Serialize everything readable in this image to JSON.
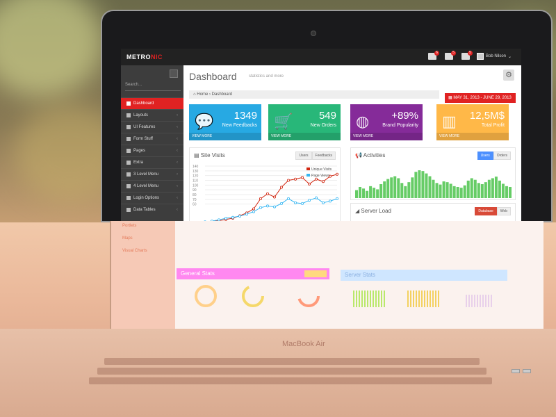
{
  "topbar": {
    "logo_main": "METRO",
    "logo_accent": "NIC",
    "notif_badges": [
      "6",
      "5",
      "5"
    ],
    "user_name": "Bob Nilson",
    "user_caret": "⌄"
  },
  "sidebar": {
    "search_placeholder": "Search...",
    "items": [
      {
        "label": "Dashboard"
      },
      {
        "label": "Layouts"
      },
      {
        "label": "UI Features"
      },
      {
        "label": "Form Stuff"
      },
      {
        "label": "Pages"
      },
      {
        "label": "Extra"
      },
      {
        "label": "3 Level Menu"
      },
      {
        "label": "4 Level Menu"
      },
      {
        "label": "Login Options"
      },
      {
        "label": "Data Tables"
      }
    ],
    "reflected_items": [
      "Portlets",
      "Maps",
      "Visual Charts"
    ]
  },
  "main": {
    "title": "Dashboard",
    "subtitle": "statistics and more",
    "date_range": "MAY 31, 2013 - JUNE 29, 2013",
    "breadcrumb": {
      "home": "Home",
      "separator": "›",
      "current": "Dashboard"
    },
    "stats": [
      {
        "value": "1349",
        "label": "New Feedbacks",
        "more": "VIEW MORE",
        "color": "#27a9e3"
      },
      {
        "value": "549",
        "label": "New Orders",
        "more": "VIEW MORE",
        "color": "#28b779"
      },
      {
        "value": "+89%",
        "label": "Brand Popularity",
        "more": "VIEW MORE",
        "color": "#852b99"
      },
      {
        "value": "12,5M$",
        "label": "Total Profit",
        "more": "VIEW MORE",
        "color": "#ffb848"
      }
    ],
    "site_visits": {
      "title": "Site Visits",
      "buttons": [
        "Users",
        "Feedbacks"
      ],
      "legend": [
        "Unique Visits",
        "Page Views"
      ]
    },
    "activities": {
      "title": "Activities",
      "buttons": [
        "Users",
        "Orders"
      ]
    },
    "server_load": {
      "title": "Server Load",
      "buttons": [
        "Database",
        "Web"
      ]
    },
    "general_stats": {
      "title": "General Stats"
    },
    "server_stats": {
      "title": "Server Stats"
    }
  },
  "chart_data": [
    {
      "type": "line",
      "title": "Site Visits",
      "ylim": [
        0,
        140
      ],
      "yticks": [
        140,
        130,
        120,
        110,
        100,
        90,
        80,
        70,
        60
      ],
      "series": [
        {
          "name": "Unique Visits",
          "color": "#d12610",
          "values": [
            2,
            4,
            6,
            9,
            12,
            18,
            25,
            35,
            60,
            72,
            64,
            88,
            105,
            108,
            112,
            96,
            108,
            102,
            115,
            120
          ]
        },
        {
          "name": "Page Views",
          "color": "#37b7f3",
          "values": [
            3,
            5,
            8,
            12,
            14,
            17,
            22,
            28,
            38,
            42,
            40,
            48,
            60,
            50,
            48,
            56,
            62,
            50,
            54,
            60
          ]
        }
      ]
    },
    {
      "type": "bar",
      "title": "Activities",
      "color": "#66cc66",
      "values": [
        20,
        28,
        24,
        18,
        30,
        26,
        22,
        35,
        42,
        48,
        52,
        55,
        50,
        38,
        30,
        40,
        52,
        66,
        70,
        68,
        62,
        55,
        46,
        38,
        34,
        42,
        40,
        36,
        30,
        28,
        26,
        32,
        44,
        50,
        46,
        38,
        35,
        40,
        46,
        50,
        54,
        44,
        36,
        30,
        28
      ]
    }
  ],
  "laptop": {
    "brand": "MacBook Air"
  }
}
